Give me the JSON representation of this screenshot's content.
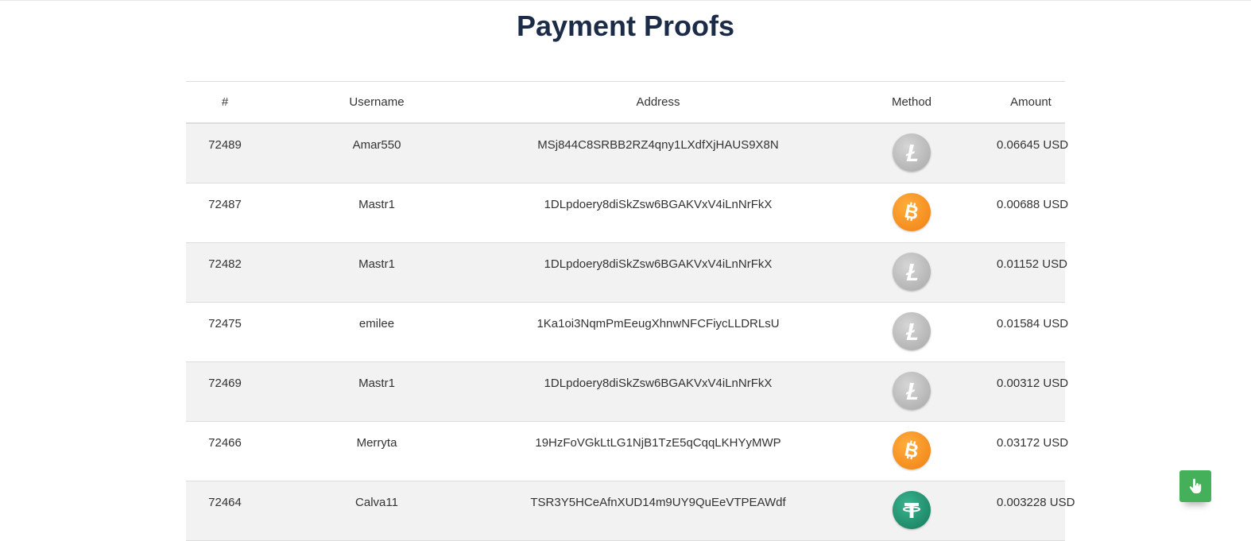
{
  "page": {
    "title": "Payment Proofs"
  },
  "table": {
    "headers": [
      "#",
      "Username",
      "Address",
      "Method",
      "Amount"
    ],
    "rows": [
      {
        "id": "72489",
        "username": "Amar550",
        "address": "MSj844C8SRBB2RZ4qny1LXdfXjHAUS9X8N",
        "method": "litecoin-icon",
        "amount": "0.06645 USD"
      },
      {
        "id": "72487",
        "username": "Mastr1",
        "address": "1DLpdoery8diSkZsw6BGAKVxV4iLnNrFkX",
        "method": "bitcoin-icon",
        "amount": "0.00688 USD"
      },
      {
        "id": "72482",
        "username": "Mastr1",
        "address": "1DLpdoery8diSkZsw6BGAKVxV4iLnNrFkX",
        "method": "litecoin-icon",
        "amount": "0.01152 USD"
      },
      {
        "id": "72475",
        "username": "emilee",
        "address": "1Ka1oi3NqmPmEeugXhnwNFCFiycLLDRLsU",
        "method": "litecoin-icon",
        "amount": "0.01584 USD"
      },
      {
        "id": "72469",
        "username": "Mastr1",
        "address": "1DLpdoery8diSkZsw6BGAKVxV4iLnNrFkX",
        "method": "litecoin-icon",
        "amount": "0.00312 USD"
      },
      {
        "id": "72466",
        "username": "Merryta",
        "address": "19HzFoVGkLtLG1NjB1TzE5qCqqLKHYyMWP",
        "method": "bitcoin-icon",
        "amount": "0.03172 USD"
      },
      {
        "id": "72464",
        "username": "Calva11",
        "address": "TSR3Y5HCeAfnXUD14m9UY9QuEeVTPEAWdf",
        "method": "tether-icon",
        "amount": "0.003228 USD"
      }
    ]
  },
  "floating_button": {
    "icon": "hand-pointer-icon",
    "color": "#44b05a"
  },
  "colors": {
    "title": "#1c2c48",
    "row_alt": "#f2f2f2",
    "bitcoin": "#f7931a",
    "litecoin": "#b5b5b5",
    "tether": "#26a17b"
  }
}
